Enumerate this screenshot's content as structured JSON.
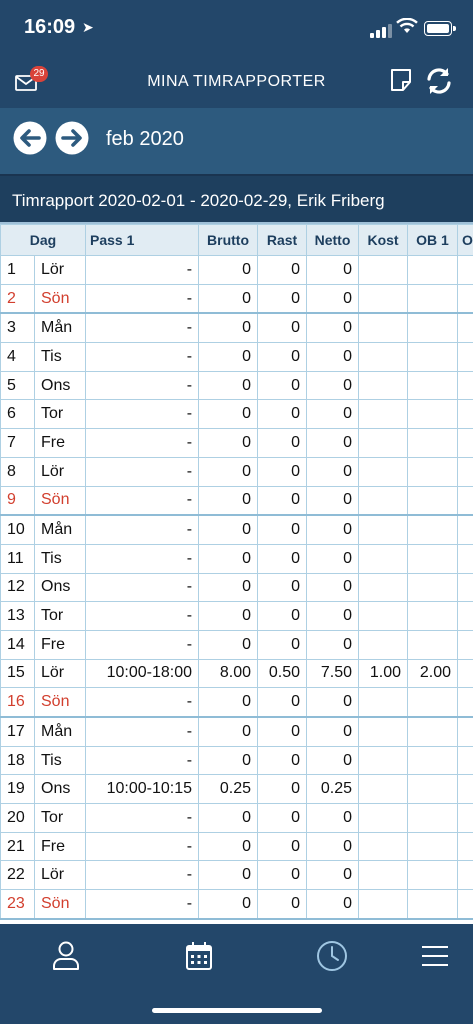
{
  "status": {
    "time": "16:09"
  },
  "nav": {
    "title": "MINA TIMRAPPORTER",
    "mail_badge": "29"
  },
  "month": {
    "label": "feb 2020"
  },
  "report": {
    "title": "Timrapport 2020-02-01 - 2020-02-29, Erik Friberg"
  },
  "table": {
    "headers": [
      "Dag",
      "Pass 1",
      "Brutto",
      "Rast",
      "Netto",
      "Kost",
      "OB 1",
      "O"
    ],
    "rows": [
      {
        "n": "1",
        "day": "Lör",
        "pass": "-",
        "brutto": "0",
        "rast": "0",
        "netto": "0",
        "kost": "",
        "ob1": "",
        "sun": false
      },
      {
        "n": "2",
        "day": "Sön",
        "pass": "-",
        "brutto": "0",
        "rast": "0",
        "netto": "0",
        "kost": "",
        "ob1": "",
        "sun": true
      },
      {
        "n": "3",
        "day": "Mån",
        "pass": "-",
        "brutto": "0",
        "rast": "0",
        "netto": "0",
        "kost": "",
        "ob1": "",
        "sun": false
      },
      {
        "n": "4",
        "day": "Tis",
        "pass": "-",
        "brutto": "0",
        "rast": "0",
        "netto": "0",
        "kost": "",
        "ob1": "",
        "sun": false
      },
      {
        "n": "5",
        "day": "Ons",
        "pass": "-",
        "brutto": "0",
        "rast": "0",
        "netto": "0",
        "kost": "",
        "ob1": "",
        "sun": false
      },
      {
        "n": "6",
        "day": "Tor",
        "pass": "-",
        "brutto": "0",
        "rast": "0",
        "netto": "0",
        "kost": "",
        "ob1": "",
        "sun": false
      },
      {
        "n": "7",
        "day": "Fre",
        "pass": "-",
        "brutto": "0",
        "rast": "0",
        "netto": "0",
        "kost": "",
        "ob1": "",
        "sun": false
      },
      {
        "n": "8",
        "day": "Lör",
        "pass": "-",
        "brutto": "0",
        "rast": "0",
        "netto": "0",
        "kost": "",
        "ob1": "",
        "sun": false
      },
      {
        "n": "9",
        "day": "Sön",
        "pass": "-",
        "brutto": "0",
        "rast": "0",
        "netto": "0",
        "kost": "",
        "ob1": "",
        "sun": true
      },
      {
        "n": "10",
        "day": "Mån",
        "pass": "-",
        "brutto": "0",
        "rast": "0",
        "netto": "0",
        "kost": "",
        "ob1": "",
        "sun": false
      },
      {
        "n": "11",
        "day": "Tis",
        "pass": "-",
        "brutto": "0",
        "rast": "0",
        "netto": "0",
        "kost": "",
        "ob1": "",
        "sun": false
      },
      {
        "n": "12",
        "day": "Ons",
        "pass": "-",
        "brutto": "0",
        "rast": "0",
        "netto": "0",
        "kost": "",
        "ob1": "",
        "sun": false
      },
      {
        "n": "13",
        "day": "Tor",
        "pass": "-",
        "brutto": "0",
        "rast": "0",
        "netto": "0",
        "kost": "",
        "ob1": "",
        "sun": false
      },
      {
        "n": "14",
        "day": "Fre",
        "pass": "-",
        "brutto": "0",
        "rast": "0",
        "netto": "0",
        "kost": "",
        "ob1": "",
        "sun": false
      },
      {
        "n": "15",
        "day": "Lör",
        "pass": "10:00-18:00",
        "brutto": "8.00",
        "rast": "0.50",
        "netto": "7.50",
        "kost": "1.00",
        "ob1": "2.00",
        "sun": false
      },
      {
        "n": "16",
        "day": "Sön",
        "pass": "-",
        "brutto": "0",
        "rast": "0",
        "netto": "0",
        "kost": "",
        "ob1": "",
        "sun": true
      },
      {
        "n": "17",
        "day": "Mån",
        "pass": "-",
        "brutto": "0",
        "rast": "0",
        "netto": "0",
        "kost": "",
        "ob1": "",
        "sun": false
      },
      {
        "n": "18",
        "day": "Tis",
        "pass": "-",
        "brutto": "0",
        "rast": "0",
        "netto": "0",
        "kost": "",
        "ob1": "",
        "sun": false
      },
      {
        "n": "19",
        "day": "Ons",
        "pass": "10:00-10:15",
        "brutto": "0.25",
        "rast": "0",
        "netto": "0.25",
        "kost": "",
        "ob1": "",
        "sun": false
      },
      {
        "n": "20",
        "day": "Tor",
        "pass": "-",
        "brutto": "0",
        "rast": "0",
        "netto": "0",
        "kost": "",
        "ob1": "",
        "sun": false
      },
      {
        "n": "21",
        "day": "Fre",
        "pass": "-",
        "brutto": "0",
        "rast": "0",
        "netto": "0",
        "kost": "",
        "ob1": "",
        "sun": false
      },
      {
        "n": "22",
        "day": "Lör",
        "pass": "-",
        "brutto": "0",
        "rast": "0",
        "netto": "0",
        "kost": "",
        "ob1": "",
        "sun": false
      },
      {
        "n": "23",
        "day": "Sön",
        "pass": "-",
        "brutto": "0",
        "rast": "0",
        "netto": "0",
        "kost": "",
        "ob1": "",
        "sun": true
      }
    ]
  },
  "tabs": [
    {
      "icon": "person-icon"
    },
    {
      "icon": "calendar-icon"
    },
    {
      "icon": "clock-icon"
    },
    {
      "icon": "menu-icon"
    }
  ],
  "colors": {
    "header": "#23476a",
    "monthbar": "#2d5a7e",
    "sunday": "#d23f2e",
    "grid": "#aed0e3"
  }
}
